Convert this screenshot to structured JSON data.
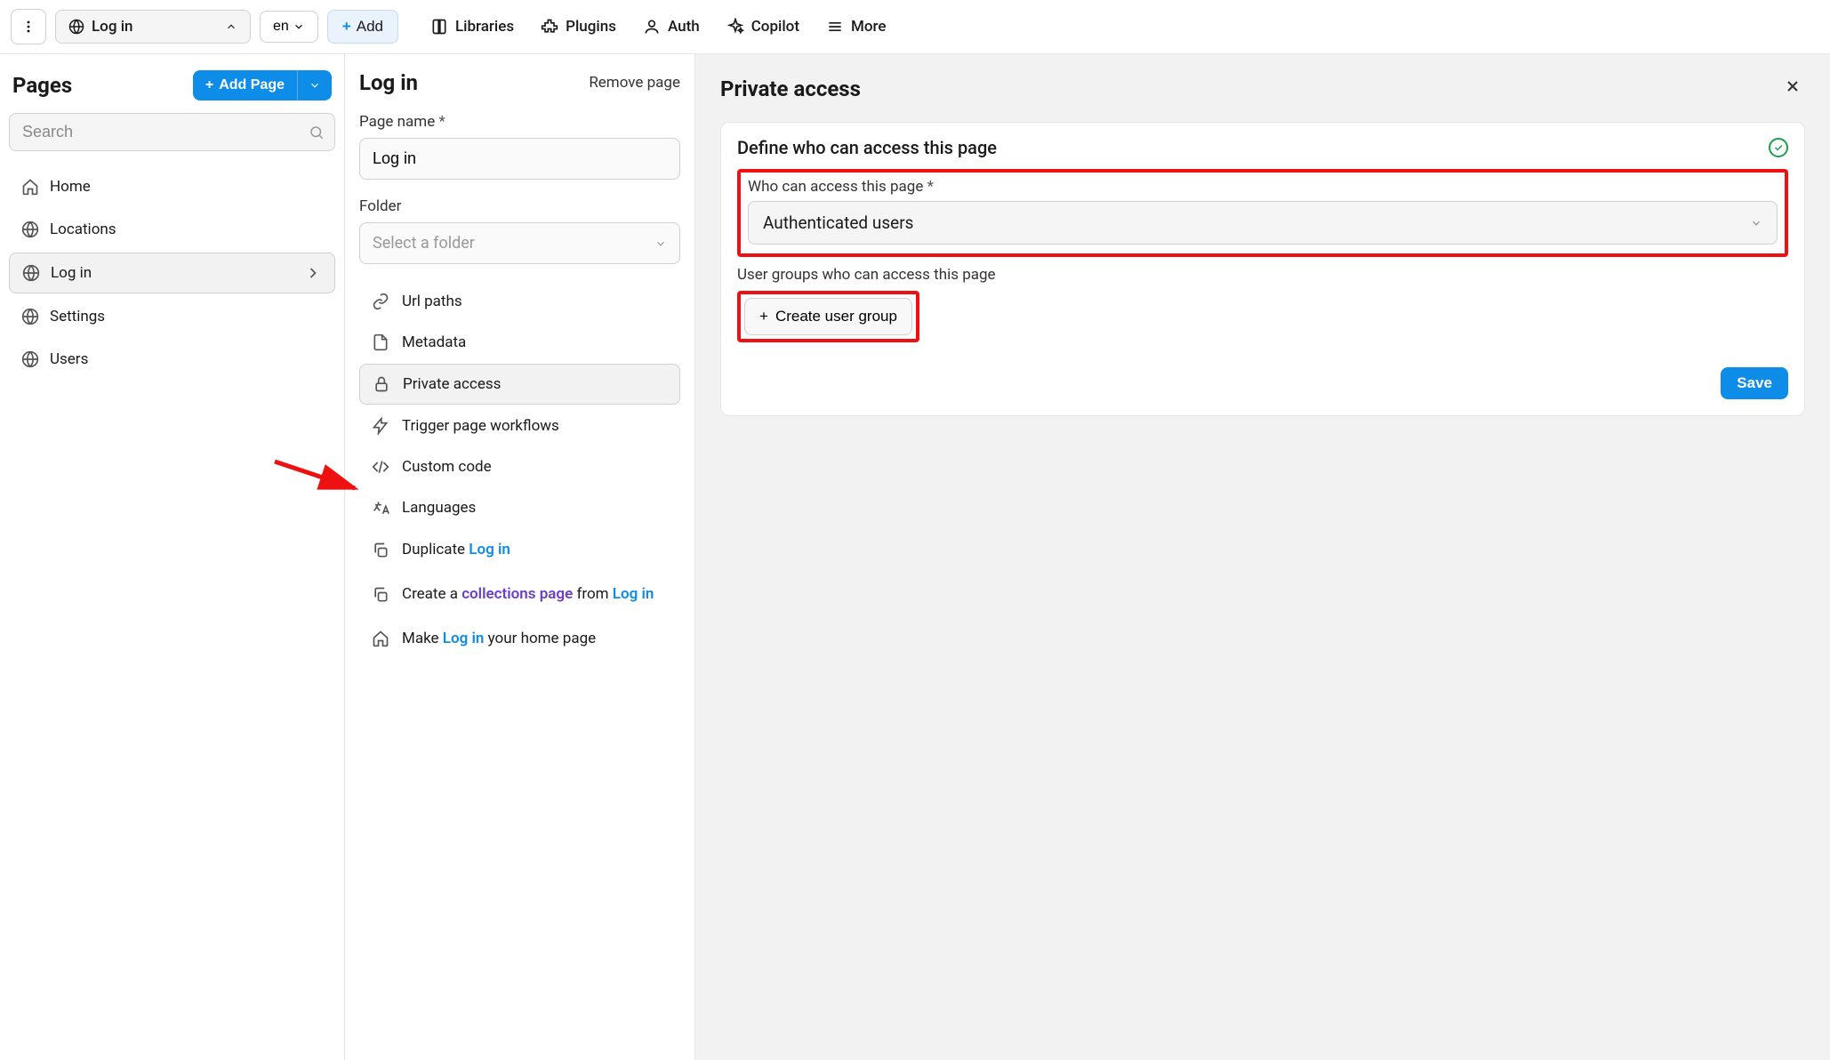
{
  "topbar": {
    "current_page": "Log in",
    "lang": "en",
    "add": "Add",
    "links": {
      "libraries": "Libraries",
      "plugins": "Plugins",
      "auth": "Auth",
      "copilot": "Copilot",
      "more": "More"
    }
  },
  "sidebar": {
    "title": "Pages",
    "add_page": "Add Page",
    "search_placeholder": "Search",
    "items": [
      {
        "label": "Home",
        "icon": "home"
      },
      {
        "label": "Locations",
        "icon": "globe"
      },
      {
        "label": "Log in",
        "icon": "globe",
        "selected": true
      },
      {
        "label": "Settings",
        "icon": "globe"
      },
      {
        "label": "Users",
        "icon": "globe"
      }
    ]
  },
  "middle": {
    "title": "Log in",
    "remove": "Remove page",
    "page_name_label": "Page name",
    "page_name_value": "Log in",
    "folder_label": "Folder",
    "folder_placeholder": "Select a folder",
    "menu": {
      "url_paths": "Url paths",
      "metadata": "Metadata",
      "private_access": "Private access",
      "trigger": "Trigger page workflows",
      "custom_code": "Custom code",
      "languages": "Languages",
      "duplicate_prefix": "Duplicate ",
      "duplicate_link": "Log in",
      "create_prefix": "Create a ",
      "create_link1": "collections page",
      "create_mid": " from ",
      "create_link2": "Log in",
      "make_prefix": "Make ",
      "make_link": "Log in",
      "make_suffix": " your home page"
    }
  },
  "right": {
    "title": "Private access",
    "card_title": "Define who can access this page",
    "who_label": "Who can access this page",
    "who_value": "Authenticated users",
    "groups_label": "User groups who can access this page",
    "create_group": "Create user group",
    "save": "Save"
  }
}
